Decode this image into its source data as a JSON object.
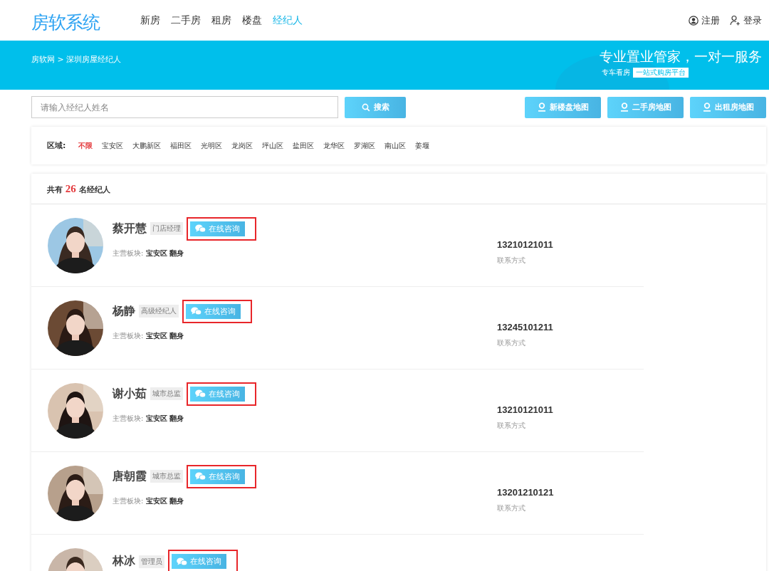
{
  "header": {
    "logo": "房软系统",
    "nav": [
      {
        "label": "新房",
        "selected": false
      },
      {
        "label": "二手房",
        "selected": false
      },
      {
        "label": "租房",
        "selected": false
      },
      {
        "label": "楼盘",
        "selected": false
      },
      {
        "label": "经纪人",
        "selected": true
      }
    ],
    "account": [
      {
        "kind": "register",
        "label": "注册"
      },
      {
        "kind": "login",
        "label": "登录"
      }
    ]
  },
  "banner": {
    "breadcrumb": "房软网 > 深圳房屋经纪人",
    "slogan": "专业置业管家，一对一服务",
    "subtitle": "专车看房",
    "badge": "一站式购房平台"
  },
  "search": {
    "placeholder": "请输入经纪人姓名",
    "button": "搜索"
  },
  "map_buttons": [
    "新楼盘地图",
    "二手房地图",
    "出租房地图"
  ],
  "filter": {
    "label": "区域:",
    "zones": [
      {
        "label": "不限",
        "selected": true
      },
      {
        "label": "宝安区",
        "selected": false
      },
      {
        "label": "大鹏新区",
        "selected": false
      },
      {
        "label": "福田区",
        "selected": false
      },
      {
        "label": "光明区",
        "selected": false
      },
      {
        "label": "龙岗区",
        "selected": false
      },
      {
        "label": "坪山区",
        "selected": false
      },
      {
        "label": "盐田区",
        "selected": false
      },
      {
        "label": "龙华区",
        "selected": false
      },
      {
        "label": "罗湖区",
        "selected": false
      },
      {
        "label": "南山区",
        "selected": false
      },
      {
        "label": "姜堰",
        "selected": false
      }
    ]
  },
  "summary": {
    "prefix": "共有",
    "count": "26",
    "suffix": "名经纪人"
  },
  "agents": [
    {
      "name": "蔡开慧",
      "title": "门店经理",
      "consult": "在线咨询",
      "highlighted": true,
      "area_label": "主营板块:",
      "area": "宝安区 翻身",
      "phone": "13210121011",
      "phone_label": "联系方式"
    },
    {
      "name": "杨静",
      "title": "高级经纪人",
      "consult": "在线咨询",
      "highlighted": true,
      "area_label": "主营板块:",
      "area": "宝安区 翻身",
      "phone": "13245101211",
      "phone_label": "联系方式"
    },
    {
      "name": "谢小茹",
      "title": "城市总监",
      "consult": "在线咨询",
      "highlighted": true,
      "area_label": "主营板块:",
      "area": "宝安区 翻身",
      "phone": "13210121011",
      "phone_label": "联系方式"
    },
    {
      "name": "唐朝霞",
      "title": "城市总监",
      "consult": "在线咨询",
      "highlighted": true,
      "area_label": "主营板块:",
      "area": "宝安区 翻身",
      "phone": "13201210121",
      "phone_label": "联系方式"
    },
    {
      "name": "林冰",
      "title": "管理员",
      "consult": "在线咨询",
      "highlighted": true
    }
  ]
}
